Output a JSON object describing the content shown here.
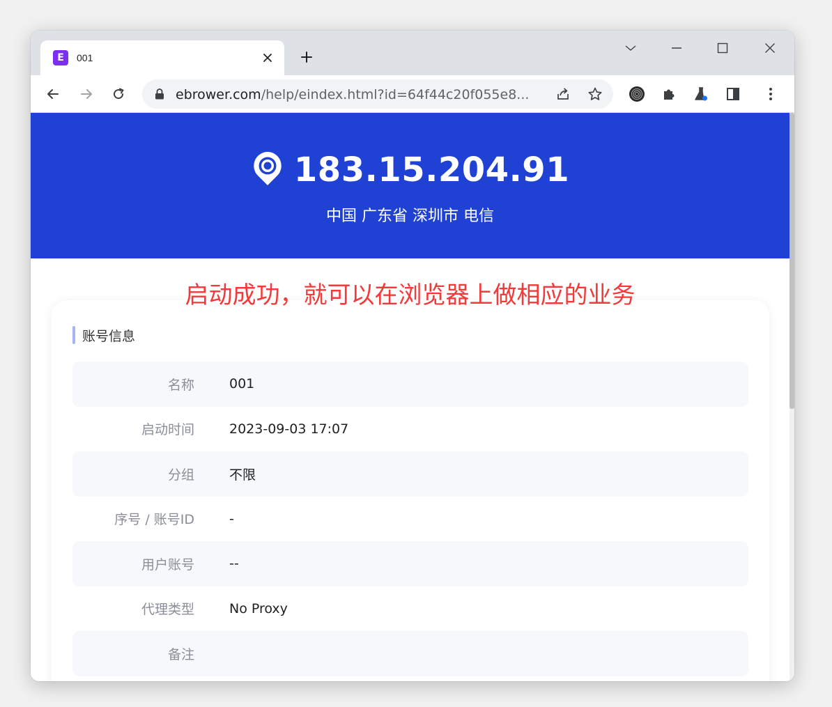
{
  "browser": {
    "tab_title": "001",
    "favicon_letter": "E",
    "url_domain": "ebrower.com",
    "url_path": "/help/eindex.html?id=64f44c20f055e8..."
  },
  "page": {
    "ip": "183.15.204.91",
    "location": "中国 广东省 深圳市 电信",
    "annotation": "启动成功，就可以在浏览器上做相应的业务",
    "section_title": "账号信息",
    "rows": [
      {
        "label": "名称",
        "value": "001"
      },
      {
        "label": "启动时间",
        "value": "2023-09-03 17:07"
      },
      {
        "label": "分组",
        "value": "不限"
      },
      {
        "label": "序号 / 账号ID",
        "value": "-"
      },
      {
        "label": "用户账号",
        "value": "--"
      },
      {
        "label": "代理类型",
        "value": "No Proxy"
      },
      {
        "label": "备注",
        "value": ""
      }
    ]
  },
  "colors": {
    "hero_bg": "#2042d4",
    "annotation": "#f23a3a",
    "accent_bar": "#a9b4f2"
  }
}
